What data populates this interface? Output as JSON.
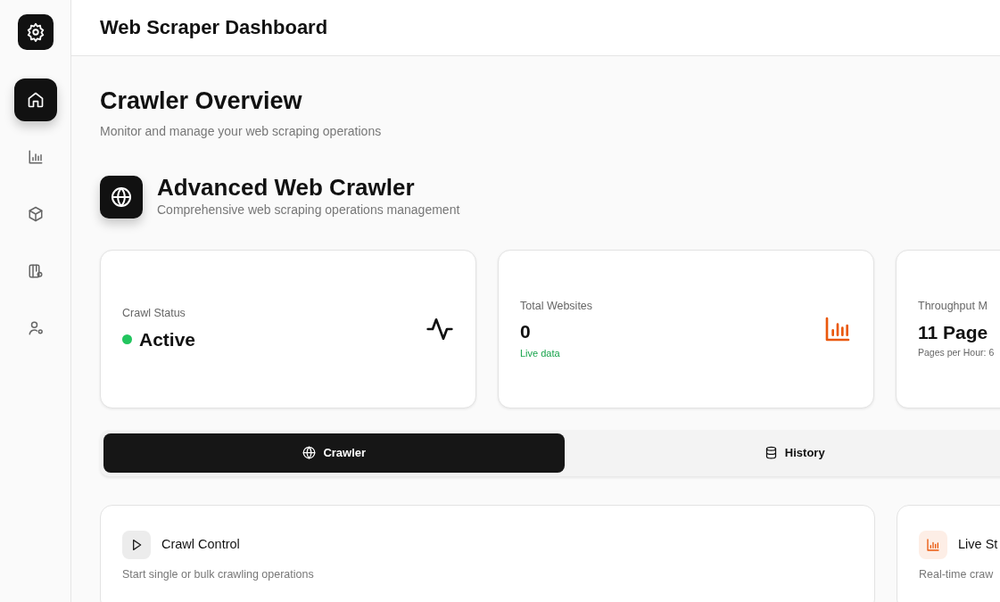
{
  "sidebar": {
    "items": [
      {
        "selected": true
      },
      {
        "selected": false
      },
      {
        "selected": false
      },
      {
        "selected": false
      },
      {
        "selected": false
      }
    ]
  },
  "header": {
    "title": "Web Scraper Dashboard"
  },
  "page": {
    "title": "Crawler Overview",
    "subtitle": "Monitor and manage your web scraping operations"
  },
  "section": {
    "title": "Advanced Web Crawler",
    "subtitle": "Comprehensive web scraping operations management"
  },
  "stats": [
    {
      "kind": "status",
      "label": "Crawl Status",
      "value": "Active",
      "color": "#22c55e"
    },
    {
      "kind": "value",
      "label": "Total Websites",
      "value": "0",
      "note": "Live data"
    },
    {
      "kind": "value",
      "label": "Throughput M",
      "value": "11 Page",
      "note": "Pages per Hour: 6"
    }
  ],
  "tabs": [
    {
      "label": "Crawler",
      "selected": true
    },
    {
      "label": "History",
      "selected": false
    }
  ],
  "panels": [
    {
      "title": "Crawl Control",
      "subtitle": "Start single or bulk crawling operations"
    },
    {
      "title": "Live St",
      "subtitle": "Real-time craw"
    }
  ]
}
